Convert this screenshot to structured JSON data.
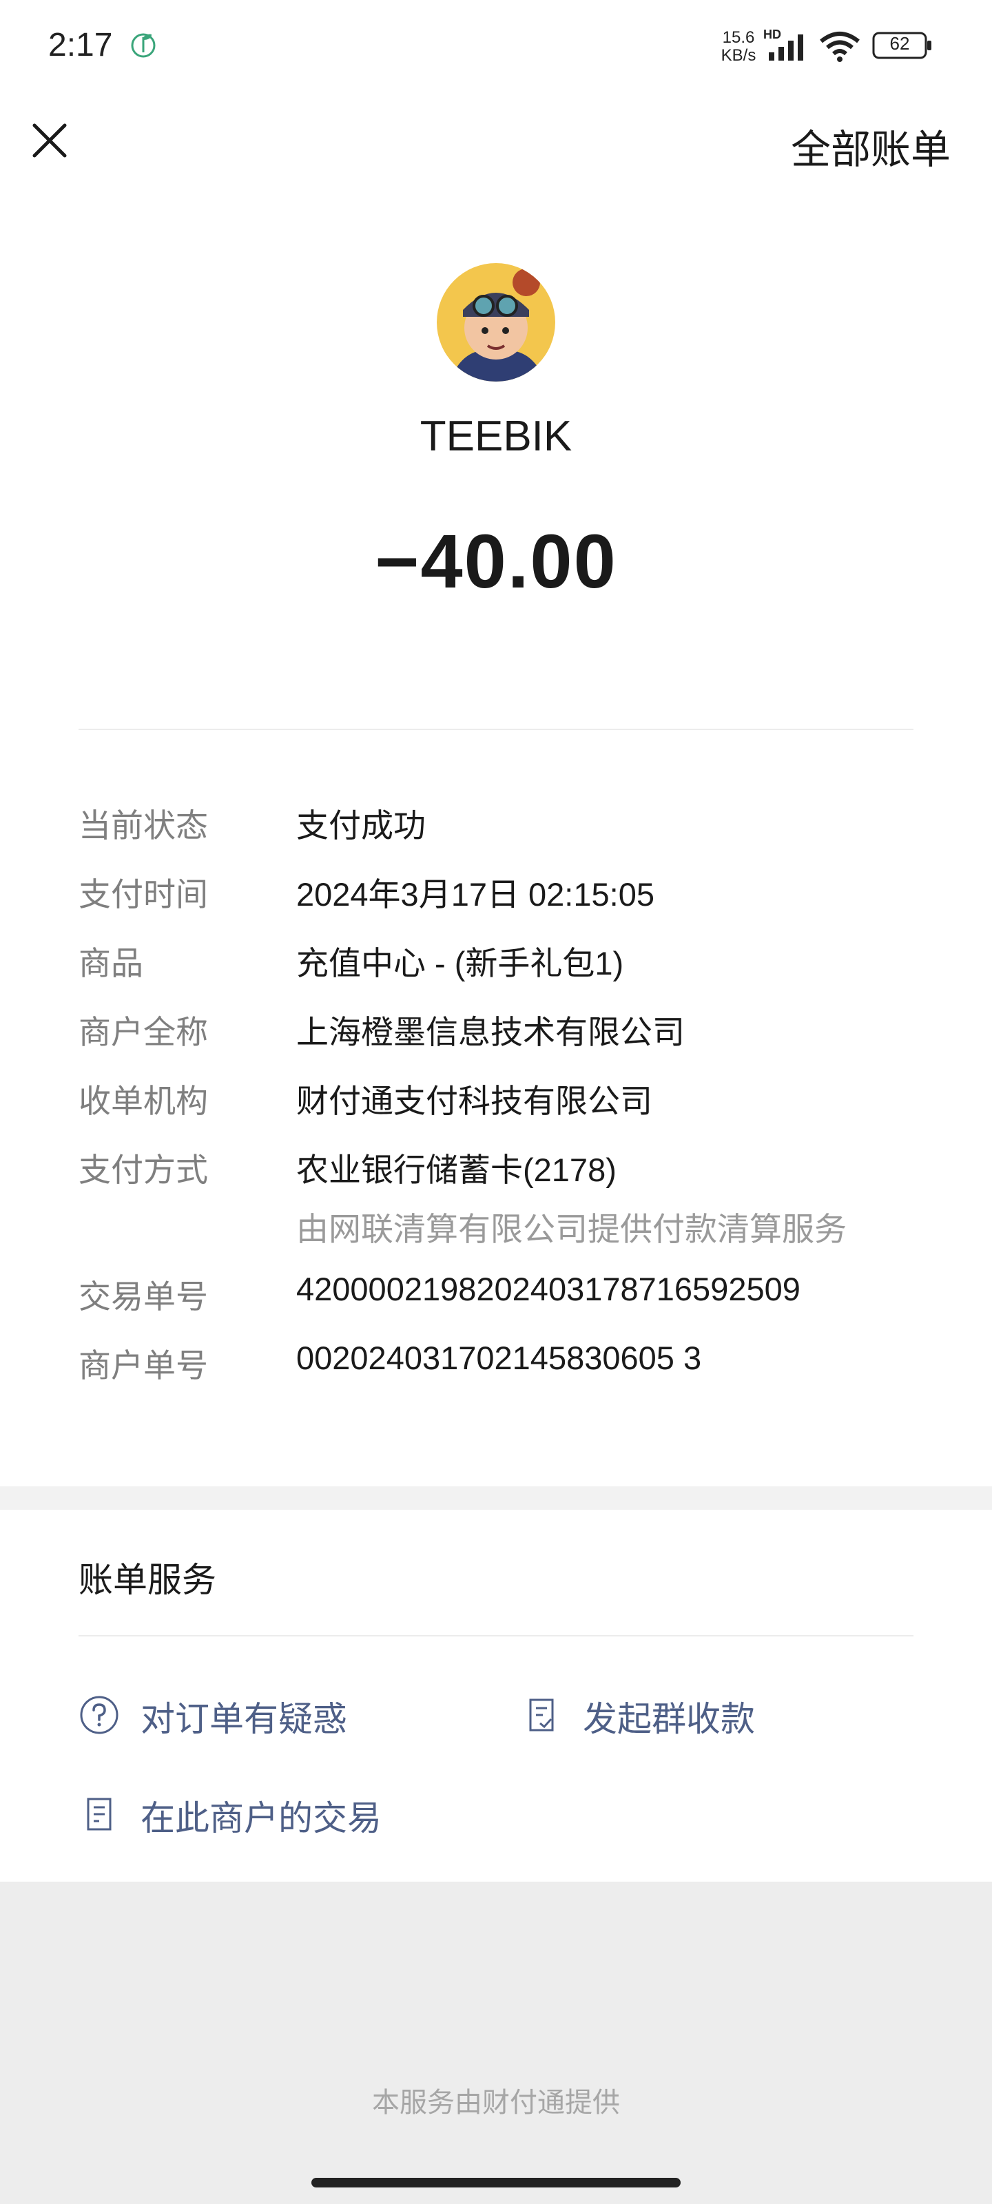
{
  "status_bar": {
    "time": "2:17",
    "net_speed": "15.6\nKB/s",
    "hd": "HD",
    "battery": "62",
    "icons": [
      "leaf-charging-icon",
      "signal-icon",
      "wifi-icon",
      "battery-icon"
    ]
  },
  "nav": {
    "close_icon": "close-icon",
    "all_bills": "全部账单"
  },
  "header": {
    "merchant_name": "TEEBIK",
    "amount": "−40.00"
  },
  "details": [
    {
      "label": "当前状态",
      "value": "支付成功"
    },
    {
      "label": "支付时间",
      "value": "2024年3月17日 02:15:05"
    },
    {
      "label": "商品",
      "value": "充值中心 - (新手礼包1)"
    },
    {
      "label": "商户全称",
      "value": "上海橙墨信息技术有限公司"
    },
    {
      "label": "收单机构",
      "value": "财付通支付科技有限公司"
    },
    {
      "label": "支付方式",
      "value": "农业银行储蓄卡(2178)",
      "sub": "由网联清算有限公司提供付款清算服务"
    },
    {
      "label": "交易单号",
      "value": "4200002198202403178716592509"
    },
    {
      "label": "商户单号",
      "value": "002024031702145830605 3"
    }
  ],
  "services": {
    "title": "账单服务",
    "items": [
      {
        "label": "对订单有疑惑",
        "icon": "question-icon"
      },
      {
        "label": "发起群收款",
        "icon": "checklist-icon"
      },
      {
        "label": "在此商户的交易",
        "icon": "document-icon"
      }
    ]
  },
  "footer": {
    "text": "本服务由财付通提供"
  },
  "colors": {
    "link": "#4e5f87",
    "label": "#7f7f7f",
    "background": "#ededed"
  }
}
